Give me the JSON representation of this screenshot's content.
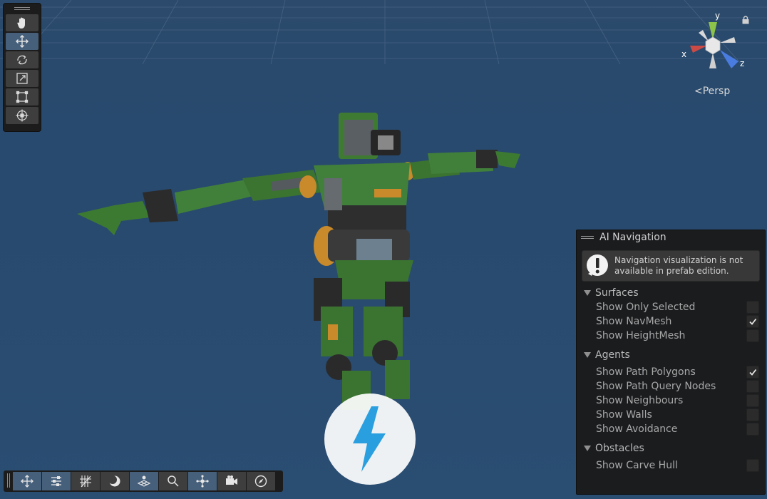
{
  "scene": {
    "persp_label": "Persp",
    "axis_labels": {
      "x": "x",
      "y": "y",
      "z": "z"
    },
    "colors": {
      "x_axis": "#cc4a45",
      "y_axis": "#8cc44a",
      "z_axis": "#4a7ce0",
      "background": "#284a6e",
      "robot_green": "#3f7a33"
    }
  },
  "tools": [
    {
      "name": "hand-tool",
      "icon": "hand-icon",
      "active": false
    },
    {
      "name": "move-tool",
      "icon": "move-icon",
      "active": true
    },
    {
      "name": "rotate-tool",
      "icon": "rotate-icon",
      "active": false
    },
    {
      "name": "scale-tool",
      "icon": "scale-icon",
      "active": false
    },
    {
      "name": "rect-tool",
      "icon": "rect-icon",
      "active": false
    },
    {
      "name": "transform-tool",
      "icon": "transform-icon",
      "active": false
    }
  ],
  "overlays": [
    {
      "name": "move-overlay",
      "icon": "move-icon",
      "active": true
    },
    {
      "name": "settings-overlay",
      "icon": "sliders-icon",
      "active": true
    },
    {
      "name": "grid-overlay",
      "icon": "grid-icon",
      "active": false
    },
    {
      "name": "lighting-overlay",
      "icon": "moon-icon",
      "active": false
    },
    {
      "name": "navmesh-overlay",
      "icon": "navmesh-icon",
      "active": true
    },
    {
      "name": "search-overlay",
      "icon": "search-icon",
      "active": false
    },
    {
      "name": "nodes-overlay",
      "icon": "nodes-icon",
      "active": true
    },
    {
      "name": "camera-overlay",
      "icon": "camera-icon",
      "active": false
    },
    {
      "name": "compass-overlay",
      "icon": "compass-icon",
      "active": false
    }
  ],
  "ai_navigation": {
    "title": "AI Navigation",
    "message": "Navigation visualization is not available in prefab edition.",
    "sections": [
      {
        "title": "Surfaces",
        "items": [
          {
            "label": "Show Only Selected",
            "checked": false
          },
          {
            "label": "Show NavMesh",
            "checked": true
          },
          {
            "label": "Show HeightMesh",
            "checked": false
          }
        ]
      },
      {
        "title": "Agents",
        "items": [
          {
            "label": "Show Path Polygons",
            "checked": true
          },
          {
            "label": "Show Path Query Nodes",
            "checked": false
          },
          {
            "label": "Show Neighbours",
            "checked": false
          },
          {
            "label": "Show Walls",
            "checked": false
          },
          {
            "label": "Show Avoidance",
            "checked": false
          }
        ]
      },
      {
        "title": "Obstacles",
        "items": [
          {
            "label": "Show Carve Hull",
            "checked": false
          }
        ]
      }
    ]
  }
}
